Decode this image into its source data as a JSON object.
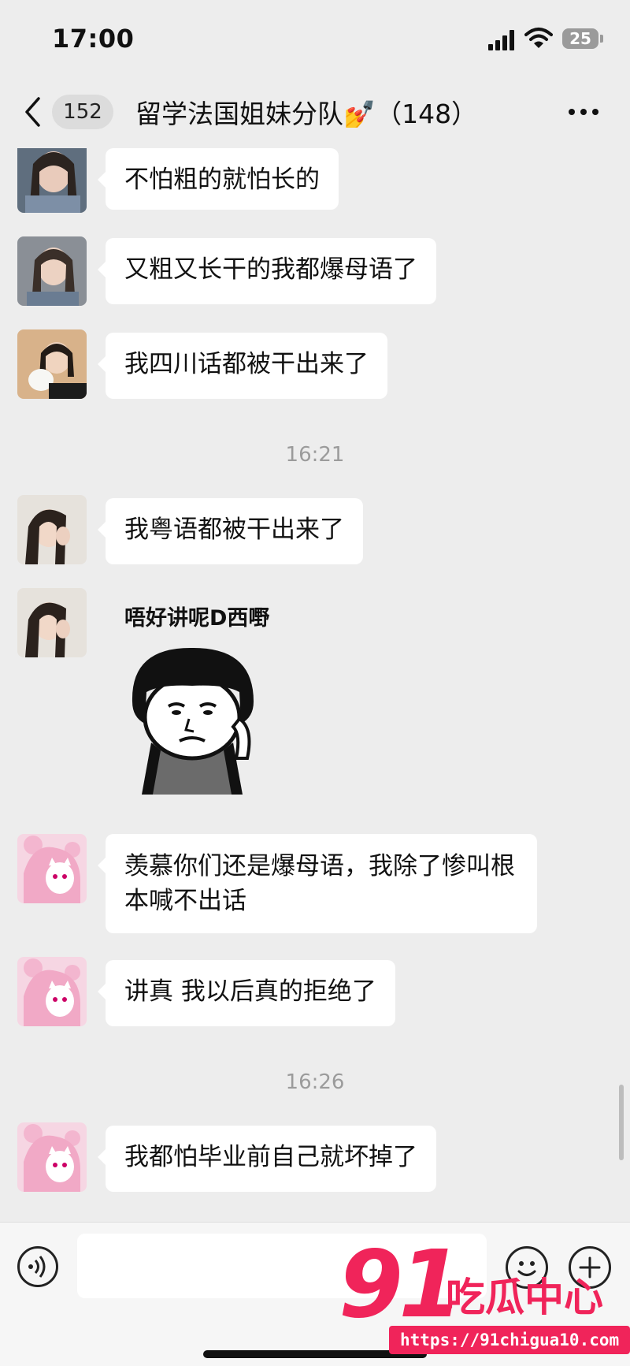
{
  "status_bar": {
    "time": "17:00",
    "battery": "25"
  },
  "header": {
    "unread_count": "152",
    "title": "留学法国姐妹分队💅（148）"
  },
  "messages": [
    {
      "text": "不怕粗的就怕长的"
    },
    {
      "text": "又粗又长干的我都爆母语了"
    },
    {
      "text": "我四川话都被干出来了"
    },
    {
      "text": "我粤语都被干出来了"
    },
    {
      "caption": "唔好讲呢D西嘢"
    },
    {
      "text": "羡慕你们还是爆母语，我除了惨叫根本喊不出话"
    },
    {
      "text": "讲真 我以后真的拒绝了"
    },
    {
      "text": "我都怕毕业前自己就坏掉了"
    }
  ],
  "timestamps": [
    "16:21",
    "16:26"
  ],
  "input": {
    "placeholder": ""
  },
  "watermark": {
    "number": "91",
    "brand": "吃瓜中心",
    "url": "https://91chigua10.com"
  },
  "colors": {
    "background": "#ededed",
    "bubble": "#ffffff",
    "watermark": "#f0245a"
  },
  "icons": [
    "back-chevron-icon",
    "more-icon",
    "voice-icon",
    "emoji-icon",
    "plus-icon",
    "signal-icon",
    "wifi-icon",
    "battery-icon"
  ]
}
